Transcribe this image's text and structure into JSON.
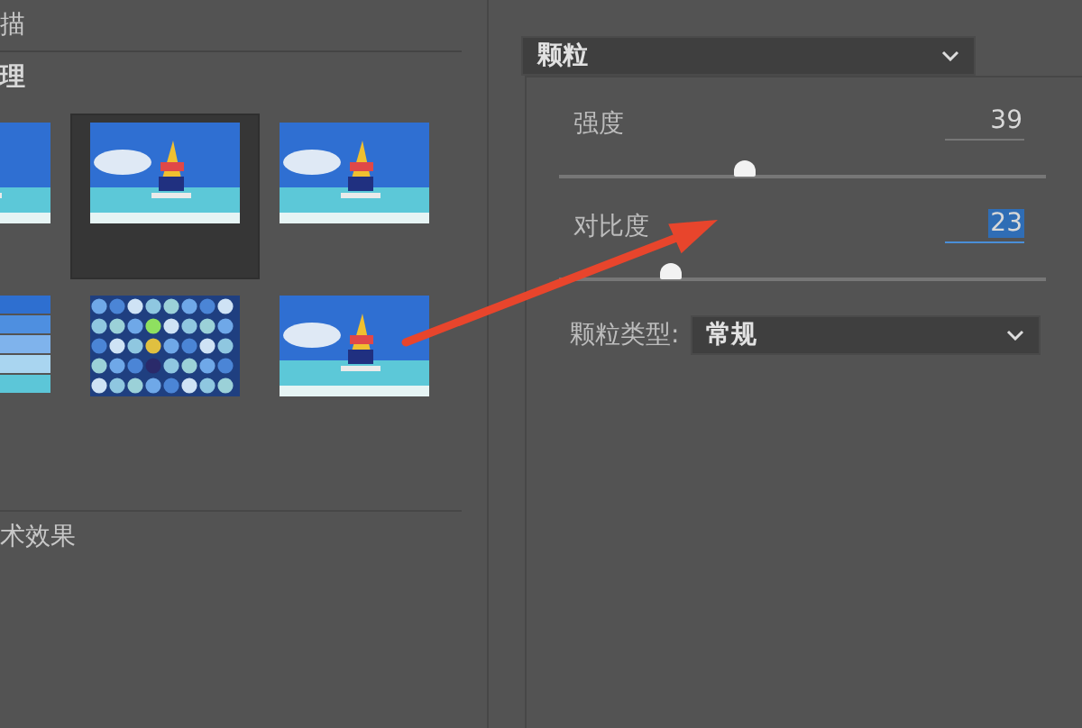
{
  "filter_groups": [
    {
      "label": "描",
      "expanded": false
    },
    {
      "label": "理",
      "expanded": true
    }
  ],
  "thumbnails": [
    {
      "kind": "photo",
      "selected": false
    },
    {
      "kind": "photo",
      "selected": true
    },
    {
      "kind": "photo",
      "selected": false
    },
    {
      "kind": "tiles",
      "selected": false
    },
    {
      "kind": "mosaic",
      "selected": false
    },
    {
      "kind": "photo",
      "selected": false
    }
  ],
  "next_group": {
    "label": "术效果"
  },
  "filter_select": {
    "value": "颗粒"
  },
  "sliders": [
    {
      "label": "强度",
      "value": "39",
      "level": 0.38,
      "focused": false
    },
    {
      "label": "对比度",
      "value": "23",
      "level": 0.23,
      "focused": true
    }
  ],
  "grain_type": {
    "label": "颗粒类型:",
    "value": "常规"
  }
}
